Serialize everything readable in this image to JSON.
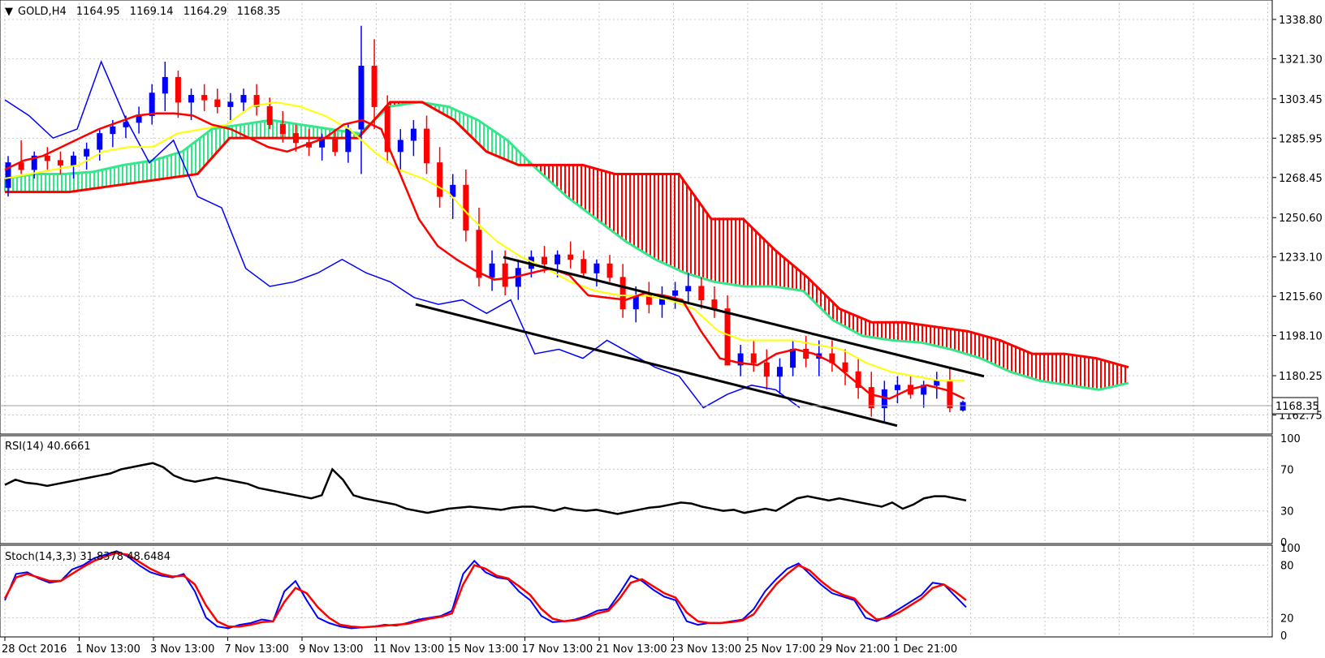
{
  "header": {
    "symbol": "GOLD,H4",
    "open": "1164.95",
    "high": "1169.14",
    "low": "1164.29",
    "close": "1168.35",
    "current_price_label": "1168.35"
  },
  "colors": {
    "bull_candle": "#0000ff",
    "bear_candle": "#ff0000",
    "tenkan": "#ff0000",
    "kijun": "#ffff00",
    "chikou": "#0000ff",
    "senkou_a": "#32e88a",
    "senkou_b": "#ff0000",
    "channel": "#000000",
    "rsi": "#000000",
    "stoch_main": "#0000ff",
    "stoch_signal": "#ff0000",
    "grid": "#c8c8c8"
  },
  "chart_data": [
    {
      "type": "candlestick",
      "title": "GOLD,H4",
      "ylim": [
        1155,
        1346
      ],
      "y_ticks": [
        "1338.80",
        "1321.30",
        "1303.45",
        "1285.95",
        "1268.45",
        "1250.60",
        "1233.10",
        "1215.60",
        "1198.10",
        "1180.25",
        "1162.75"
      ],
      "x_ticks": [
        "28 Oct 2016",
        "1 Nov 13:00",
        "3 Nov 13:00",
        "7 Nov 13:00",
        "9 Nov 13:00",
        "11 Nov 13:00",
        "15 Nov 13:00",
        "17 Nov 13:00",
        "21 Nov 13:00",
        "23 Nov 13:00",
        "25 Nov 17:00",
        "29 Nov 21:00",
        "1 Dec 21:00"
      ],
      "ohlc": [
        [
          1264,
          1278,
          1260,
          1275
        ],
        [
          1275,
          1285,
          1270,
          1272
        ],
        [
          1272,
          1280,
          1268,
          1278
        ],
        [
          1278,
          1282,
          1272,
          1276
        ],
        [
          1276,
          1280,
          1270,
          1274
        ],
        [
          1274,
          1280,
          1268,
          1278
        ],
        [
          1278,
          1284,
          1272,
          1281
        ],
        [
          1281,
          1290,
          1276,
          1288
        ],
        [
          1288,
          1294,
          1282,
          1291
        ],
        [
          1291,
          1296,
          1286,
          1293
        ],
        [
          1293,
          1300,
          1288,
          1296
        ],
        [
          1296,
          1310,
          1292,
          1306
        ],
        [
          1306,
          1320,
          1298,
          1313
        ],
        [
          1313,
          1316,
          1295,
          1302
        ],
        [
          1302,
          1308,
          1294,
          1305
        ],
        [
          1305,
          1310,
          1298,
          1303
        ],
        [
          1303,
          1308,
          1297,
          1300
        ],
        [
          1300,
          1306,
          1294,
          1302
        ],
        [
          1302,
          1308,
          1298,
          1305
        ],
        [
          1305,
          1310,
          1296,
          1300
        ],
        [
          1300,
          1304,
          1290,
          1292
        ],
        [
          1292,
          1298,
          1284,
          1288
        ],
        [
          1288,
          1292,
          1280,
          1284
        ],
        [
          1284,
          1290,
          1278,
          1282
        ],
        [
          1282,
          1288,
          1276,
          1286
        ],
        [
          1286,
          1290,
          1278,
          1280
        ],
        [
          1280,
          1292,
          1275,
          1290
        ],
        [
          1290,
          1336,
          1270,
          1318
        ],
        [
          1318,
          1330,
          1290,
          1300
        ],
        [
          1300,
          1305,
          1275,
          1280
        ],
        [
          1280,
          1290,
          1272,
          1285
        ],
        [
          1285,
          1294,
          1278,
          1290
        ],
        [
          1290,
          1296,
          1270,
          1275
        ],
        [
          1275,
          1282,
          1255,
          1260
        ],
        [
          1260,
          1270,
          1250,
          1265
        ],
        [
          1265,
          1272,
          1240,
          1245
        ],
        [
          1245,
          1255,
          1220,
          1224
        ],
        [
          1224,
          1236,
          1218,
          1230
        ],
        [
          1230,
          1236,
          1216,
          1220
        ],
        [
          1220,
          1232,
          1214,
          1228
        ],
        [
          1228,
          1236,
          1224,
          1233
        ],
        [
          1233,
          1238,
          1226,
          1230
        ],
        [
          1230,
          1236,
          1224,
          1234
        ],
        [
          1234,
          1240,
          1228,
          1232
        ],
        [
          1232,
          1236,
          1224,
          1226
        ],
        [
          1226,
          1232,
          1220,
          1230
        ],
        [
          1230,
          1234,
          1222,
          1224
        ],
        [
          1224,
          1230,
          1206,
          1210
        ],
        [
          1210,
          1220,
          1204,
          1216
        ],
        [
          1216,
          1222,
          1208,
          1212
        ],
        [
          1212,
          1220,
          1206,
          1216
        ],
        [
          1216,
          1222,
          1210,
          1218
        ],
        [
          1218,
          1226,
          1212,
          1220
        ],
        [
          1220,
          1224,
          1210,
          1214
        ],
        [
          1214,
          1220,
          1206,
          1210
        ],
        [
          1210,
          1216,
          1196,
          1185
        ],
        [
          1185,
          1194,
          1180,
          1190
        ],
        [
          1190,
          1196,
          1182,
          1186
        ],
        [
          1186,
          1192,
          1174,
          1180
        ],
        [
          1180,
          1188,
          1172,
          1184
        ],
        [
          1184,
          1196,
          1180,
          1192
        ],
        [
          1192,
          1198,
          1184,
          1188
        ],
        [
          1188,
          1196,
          1180,
          1190
        ],
        [
          1190,
          1196,
          1182,
          1186
        ],
        [
          1186,
          1192,
          1176,
          1182
        ],
        [
          1182,
          1188,
          1170,
          1175
        ],
        [
          1175,
          1182,
          1162,
          1166
        ],
        [
          1166,
          1178,
          1160,
          1174
        ],
        [
          1174,
          1180,
          1168,
          1176
        ],
        [
          1176,
          1180,
          1170,
          1172
        ],
        [
          1172,
          1178,
          1166,
          1176
        ],
        [
          1176,
          1182,
          1170,
          1178
        ],
        [
          1178,
          1184,
          1164,
          1166
        ],
        [
          1164.95,
          1169.14,
          1164.29,
          1168.35
        ]
      ],
      "tenkan": [
        1272,
        1276,
        1278,
        1282,
        1286,
        1290,
        1293,
        1296,
        1297,
        1297,
        1296,
        1292,
        1290,
        1286,
        1282,
        1280,
        1283,
        1286,
        1292,
        1294,
        1290,
        1270,
        1250,
        1238,
        1232,
        1227,
        1223,
        1224,
        1226,
        1228,
        1225,
        1216,
        1215,
        1214,
        1217,
        1216,
        1214,
        1200,
        1188,
        1186,
        1185,
        1190,
        1192,
        1190,
        1186,
        1179,
        1172,
        1170,
        1174,
        1176,
        1174,
        1170
      ],
      "kijun": [
        1268,
        1270,
        1272,
        1274,
        1280,
        1282,
        1282,
        1288,
        1290,
        1292,
        1300,
        1302,
        1300,
        1296,
        1290,
        1280,
        1272,
        1268,
        1262,
        1250,
        1240,
        1233,
        1228,
        1222,
        1218,
        1216,
        1216,
        1214,
        1210,
        1200,
        1196,
        1196,
        1196,
        1194,
        1192,
        1186,
        1182,
        1180,
        1178,
        1178
      ],
      "chikou": [
        1303,
        1296,
        1286,
        1290,
        1320,
        1295,
        1275,
        1285,
        1260,
        1255,
        1228,
        1220,
        1222,
        1226,
        1232,
        1226,
        1222,
        1215,
        1212,
        1214,
        1208,
        1214,
        1190,
        1192,
        1188,
        1196,
        1190,
        1184,
        1180,
        1166,
        1172,
        1176,
        1174,
        1166
      ],
      "senkou_a": [
        1268,
        1270,
        1270,
        1271,
        1274,
        1276,
        1280,
        1290,
        1292,
        1294,
        1292,
        1290,
        1288,
        1300,
        1302,
        1300,
        1294,
        1285,
        1272,
        1260,
        1250,
        1240,
        1232,
        1226,
        1222,
        1220,
        1220,
        1218,
        1205,
        1198,
        1196,
        1195,
        1192,
        1188,
        1182,
        1178,
        1176,
        1174,
        1177
      ],
      "senkou_b": [
        1262,
        1262,
        1262,
        1264,
        1266,
        1268,
        1270,
        1286,
        1286,
        1286,
        1286,
        1286,
        1302,
        1302,
        1294,
        1280,
        1274,
        1274,
        1274,
        1270,
        1270,
        1270,
        1250,
        1250,
        1236,
        1224,
        1210,
        1204,
        1204,
        1202,
        1200,
        1196,
        1190,
        1190,
        1188,
        1184
      ],
      "channel_upper": [
        [
          1233,
          0
        ],
        [
          1180,
          1
        ]
      ],
      "channel_lower": [
        [
          1212,
          0
        ],
        [
          1158,
          1
        ]
      ]
    },
    {
      "type": "line",
      "title": "RSI(14) 40.6661",
      "ylim": [
        0,
        100
      ],
      "y_ticks": [
        "100",
        "70",
        "30",
        "0"
      ],
      "series": [
        {
          "name": "RSI(14)",
          "values": [
            55,
            60,
            57,
            56,
            54,
            56,
            58,
            60,
            62,
            64,
            66,
            70,
            72,
            74,
            76,
            72,
            64,
            60,
            58,
            60,
            62,
            60,
            58,
            56,
            52,
            50,
            48,
            46,
            44,
            42,
            45,
            70,
            60,
            45,
            42,
            40,
            38,
            36,
            32,
            30,
            28,
            30,
            32,
            33,
            34,
            33,
            32,
            31,
            33,
            34,
            34,
            32,
            30,
            33,
            31,
            30,
            31,
            29,
            27,
            29,
            31,
            33,
            34,
            36,
            38,
            37,
            34,
            32,
            30,
            31,
            28,
            30,
            32,
            30,
            36,
            42,
            44,
            42,
            40,
            42,
            40,
            38,
            36,
            34,
            38,
            32,
            36,
            42,
            44,
            44,
            42,
            40
          ]
        }
      ]
    },
    {
      "type": "line",
      "title": "Stoch(14,3,3) 31.8378 48.6484",
      "ylim": [
        0,
        100
      ],
      "y_ticks": [
        "100",
        "80",
        "20",
        "0"
      ],
      "series": [
        {
          "name": "main",
          "values": [
            40,
            70,
            72,
            65,
            60,
            62,
            75,
            80,
            88,
            92,
            96,
            90,
            80,
            72,
            68,
            66,
            70,
            50,
            20,
            10,
            8,
            12,
            14,
            18,
            16,
            50,
            62,
            40,
            20,
            14,
            10,
            8,
            9,
            10,
            12,
            11,
            14,
            18,
            20,
            22,
            28,
            70,
            85,
            72,
            66,
            64,
            50,
            40,
            22,
            15,
            16,
            18,
            22,
            28,
            30,
            48,
            68,
            62,
            52,
            44,
            40,
            16,
            12,
            14,
            14,
            16,
            18,
            30,
            50,
            64,
            76,
            82,
            70,
            58,
            48,
            44,
            40,
            20,
            16,
            22,
            30,
            38,
            46,
            60,
            58,
            45,
            32
          ]
        },
        {
          "name": "signal",
          "values": [
            42,
            66,
            70,
            66,
            62,
            62,
            70,
            78,
            85,
            90,
            94,
            92,
            84,
            76,
            70,
            67,
            68,
            58,
            34,
            16,
            10,
            10,
            12,
            15,
            16,
            38,
            54,
            48,
            32,
            20,
            12,
            10,
            9,
            10,
            11,
            12,
            13,
            16,
            19,
            21,
            25,
            58,
            80,
            76,
            68,
            65,
            56,
            46,
            30,
            19,
            16,
            17,
            20,
            25,
            28,
            42,
            60,
            64,
            56,
            48,
            43,
            26,
            16,
            14,
            14,
            15,
            17,
            24,
            42,
            58,
            70,
            80,
            74,
            62,
            52,
            46,
            42,
            28,
            18,
            20,
            26,
            34,
            42,
            54,
            58,
            50,
            40
          ]
        }
      ]
    }
  ]
}
